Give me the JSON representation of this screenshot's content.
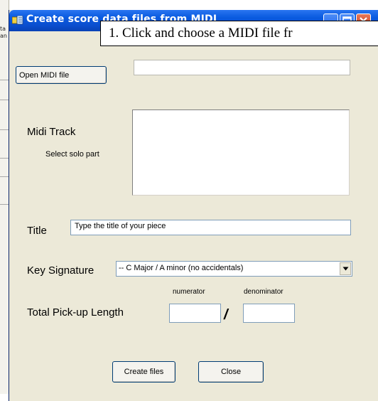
{
  "background": {
    "edge_text": [
      "ta",
      "an"
    ]
  },
  "window": {
    "title": "Create score data files from MIDI",
    "icons": {
      "app": "app-icon",
      "minimize": "minimize-icon",
      "maximize": "maximize-icon",
      "close": "close-icon"
    }
  },
  "tooltip": {
    "text": "1. Click and choose a MIDI file fr"
  },
  "open_midi": {
    "button_label": "Open MIDI file",
    "path_value": ""
  },
  "midi_track": {
    "label": "Midi Track",
    "hint": "Select solo part",
    "items": []
  },
  "title_field": {
    "label": "Title",
    "value": "Type the title of your piece"
  },
  "key_signature": {
    "label": "Key Signature",
    "selected": "-- C Major  / A minor (no accidentals)",
    "arrow_icon": "dropdown-arrow-icon"
  },
  "pickup": {
    "label": "Total Pick-up Length",
    "numerator_label": "numerator",
    "denominator_label": "denominator",
    "separator": "/",
    "numerator_value": "",
    "denominator_value": ""
  },
  "actions": {
    "create_label": "Create files",
    "close_label": "Close"
  },
  "colors": {
    "titlebar": "#0a5be0",
    "dialog_bg": "#ece9d8",
    "close_button": "#c9381a"
  }
}
